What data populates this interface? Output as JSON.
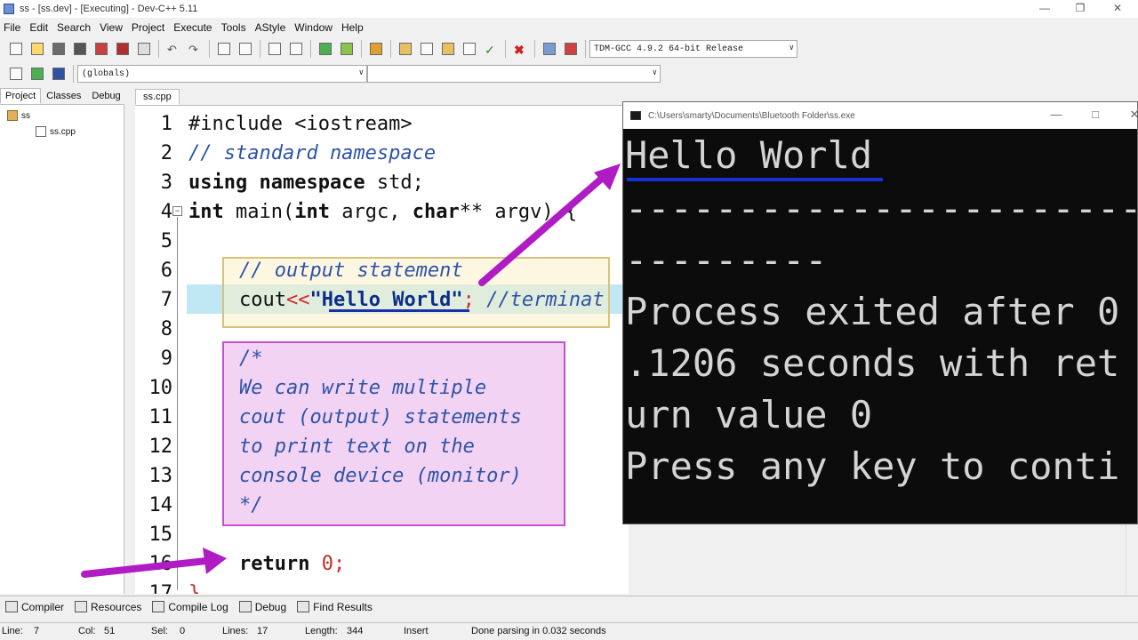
{
  "window": {
    "title": "ss - [ss.dev] - [Executing] - Dev-C++ 5.11",
    "minimize": "—",
    "restore": "❒",
    "close": "✕"
  },
  "menu": [
    "File",
    "Edit",
    "Search",
    "View",
    "Project",
    "Execute",
    "Tools",
    "AStyle",
    "Window",
    "Help"
  ],
  "toolbar": {
    "compiler_combo": "TDM-GCC 4.9.2 64-bit Release",
    "scope_combo": "(globals)",
    "function_combo": ""
  },
  "left_panel": {
    "tabs": [
      "Project",
      "Classes",
      "Debug"
    ],
    "tree": {
      "project": "ss",
      "file": "ss.cpp"
    }
  },
  "editor": {
    "tab": "ss.cpp",
    "line_numbers": [
      "1",
      "2",
      "3",
      "4",
      "5",
      "6",
      "7",
      "8",
      "9",
      "10",
      "11",
      "12",
      "13",
      "14",
      "15",
      "16",
      "17"
    ],
    "lines": {
      "l1": "#include <iostream>",
      "l2": "// standard namespace",
      "l3a": "using namespace",
      "l3b": " std;",
      "l4a": "int",
      "l4b": " main(",
      "l4c": "int",
      "l4d": " argc, ",
      "l4e": "char",
      "l4f": "** argv) {",
      "l6": "// output statement",
      "l7a": "cout",
      "l7b": "<<",
      "l7c": "\"Hello World\"",
      "l7d": ";",
      "l7e": " //terminat",
      "l9": "/*",
      "l10": "We can write multiple",
      "l11": "cout (output) statements",
      "l12": "to print text on the",
      "l13": "console device (monitor)",
      "l14": "*/",
      "l16a": "return",
      "l16b": " 0",
      "l16c": ";",
      "l17": "}"
    }
  },
  "console": {
    "title": "C:\\Users\\smarty\\Documents\\Bluetooth Folder\\ss.exe",
    "lines": [
      "Hello World",
      "--------------------------------",
      "---------",
      "Process exited after 0",
      ".1206 seconds with ret",
      "urn value 0",
      "Press any key to conti"
    ]
  },
  "bottom_tabs": [
    "Compiler",
    "Resources",
    "Compile Log",
    "Debug",
    "Find Results"
  ],
  "status": {
    "line_label": "Line:",
    "line": "7",
    "col_label": "Col:",
    "col": "51",
    "sel_label": "Sel:",
    "sel": "0",
    "lines_label": "Lines:",
    "lines": "17",
    "length_label": "Length:",
    "length": "344",
    "mode": "Insert",
    "message": "Done parsing in 0.032 seconds"
  },
  "colors": {
    "accent_arrow": "#b01cc4",
    "console_bg": "#0c0c0c",
    "line_highlight": "#bfe8f4",
    "comment_box": "#f3d3f3"
  }
}
